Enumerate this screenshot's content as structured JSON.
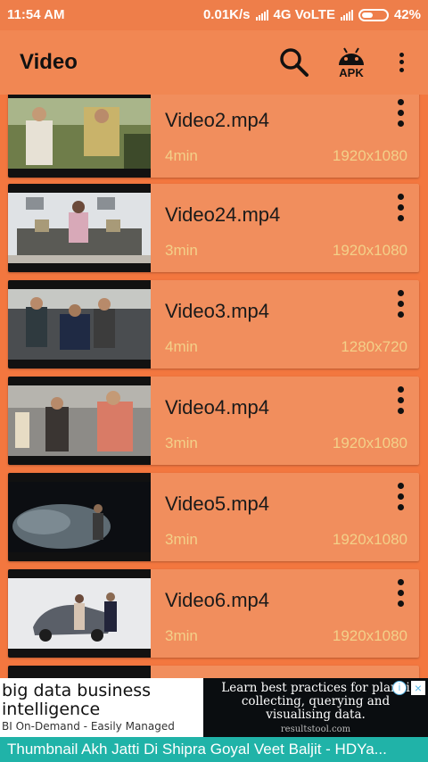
{
  "status_bar": {
    "time": "11:54 AM",
    "speed": "0.01K/s",
    "network": "4G VoLTE",
    "battery": "42%"
  },
  "app_bar": {
    "title": "Video",
    "search_icon": "search-icon",
    "apk_label": "APK",
    "menu_icon": "more-vert-icon"
  },
  "videos": [
    {
      "title": "Video2.mp4",
      "duration": "4min",
      "resolution": "1920x1080"
    },
    {
      "title": "Video24.mp4",
      "duration": "3min",
      "resolution": "1920x1080"
    },
    {
      "title": "Video3.mp4",
      "duration": "4min",
      "resolution": "1280x720"
    },
    {
      "title": "Video4.mp4",
      "duration": "3min",
      "resolution": "1920x1080"
    },
    {
      "title": "Video5.mp4",
      "duration": "3min",
      "resolution": "1920x1080"
    },
    {
      "title": "Video6.mp4",
      "duration": "3min",
      "resolution": "1920x1080"
    }
  ],
  "ad": {
    "headline": "big data business intelligence",
    "subline": "BI On-Demand - Easily Managed",
    "right_text": "Learn best practices for planni collecting, querying and visualising data.",
    "source": "resultstool.com",
    "info": "i",
    "close": "×"
  },
  "ticker": {
    "text": "Thumbnail Akh Jatti Di Shipra Goyal  Veet Baljit - HDYa..."
  },
  "colors": {
    "background": "#f3773f",
    "card": "#f18e5d",
    "accent_text": "#f3d089",
    "ticker": "#20b3a8"
  }
}
